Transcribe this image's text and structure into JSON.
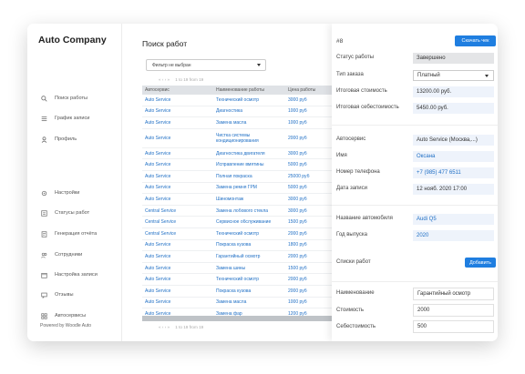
{
  "brand": "Auto Company",
  "nav": [
    {
      "label": "Поиск работы",
      "icon": "search-icon"
    },
    {
      "label": "График записи",
      "icon": "list-icon"
    },
    {
      "label": "Профиль",
      "icon": "user-icon"
    },
    {
      "label": "Настройки",
      "icon": "gear-icon"
    },
    {
      "label": "Статусы работ",
      "icon": "status-icon"
    },
    {
      "label": "Генерация отчёта",
      "icon": "report-icon"
    },
    {
      "label": "Сотрудники",
      "icon": "team-icon"
    },
    {
      "label": "Настройка записи",
      "icon": "calendar-icon"
    },
    {
      "label": "Отзывы",
      "icon": "chat-icon"
    },
    {
      "label": "Автосервисы",
      "icon": "grid-icon"
    }
  ],
  "powered": "Powered by Woodle Auto",
  "page_title": "Поиск работ",
  "filter": {
    "value": "Фильтр не выбран"
  },
  "pager": {
    "arrows": "« ‹ › »",
    "info": "1 to 19 from 19"
  },
  "table": {
    "columns": [
      "Автосервис",
      "Наименование работы",
      "Цена работы"
    ],
    "rows": [
      [
        "Auto Service",
        "Технический осмотр",
        "3000 руб"
      ],
      [
        "Auto Service",
        "Диагностика",
        "1000 руб"
      ],
      [
        "Auto Service",
        "Замена масла",
        "1000 руб"
      ],
      [
        "Auto Service",
        "Чистка системы кондиционирования",
        "2000 руб"
      ],
      [
        "Auto Service",
        "Диагностика двигателя",
        "3000 руб"
      ],
      [
        "Auto Service",
        "Исправление вмятины",
        "5000 руб"
      ],
      [
        "Auto Service",
        "Полная покраска",
        "25000 руб"
      ],
      [
        "Auto Service",
        "Замена ремня ГРМ",
        "5000 руб"
      ],
      [
        "Auto Service",
        "Шиномонтаж",
        "3000 руб"
      ],
      [
        "Central Service",
        "Замена лобового стекла",
        "3000 руб"
      ],
      [
        "Central Service",
        "Сервисное обслуживание",
        "1500 руб"
      ],
      [
        "Central Service",
        "Технический осмотр",
        "2000 руб"
      ],
      [
        "Auto Service",
        "Покраска кузова",
        "1800 руб"
      ],
      [
        "Auto Service",
        "Гарантийный осмотр",
        "2000 руб"
      ],
      [
        "Auto Service",
        "Замена шины",
        "1500 руб"
      ],
      [
        "Auto Service",
        "Технический осмотр",
        "2000 руб"
      ],
      [
        "Auto Service",
        "Покраска кузова",
        "2000 руб"
      ],
      [
        "Auto Service",
        "Замена масла",
        "1000 руб"
      ],
      [
        "Auto Service",
        "Замена фар",
        "1200 руб"
      ]
    ]
  },
  "panel": {
    "order_number": "#8",
    "check_button": "Скачать чек",
    "fields_top": [
      {
        "label": "Статус работы",
        "value": "Завершено"
      },
      {
        "label": "Тип заказа",
        "value": "Платный"
      },
      {
        "label": "Итоговая стоимость",
        "value": "13200.00 руб."
      },
      {
        "label": "Итоговая себестоимость",
        "value": "5450.00 руб."
      }
    ],
    "fields_client": [
      {
        "label": "Автосервис",
        "value": "Auto Service (Москва,...)"
      },
      {
        "label": "Имя",
        "value": "Оксана"
      },
      {
        "label": "Номер телефона",
        "value": "+7 (985) 477 6511"
      },
      {
        "label": "Дата записи",
        "value": "12 нояб. 2020 17:00"
      }
    ],
    "fields_car": [
      {
        "label": "Название автомобиля",
        "value": "Audi Q5"
      },
      {
        "label": "Год выпуска",
        "value": "2020"
      }
    ],
    "works_label": "Списки работ",
    "add_button": "Добавить",
    "fields_work": [
      {
        "label": "Наименование",
        "value": "Гарантийный осмотр"
      },
      {
        "label": "Стоимость",
        "value": "2000"
      },
      {
        "label": "Себестоимость",
        "value": "500"
      }
    ]
  },
  "colors": {
    "accent": "#1f7ee0",
    "link": "#1f6fc5"
  }
}
